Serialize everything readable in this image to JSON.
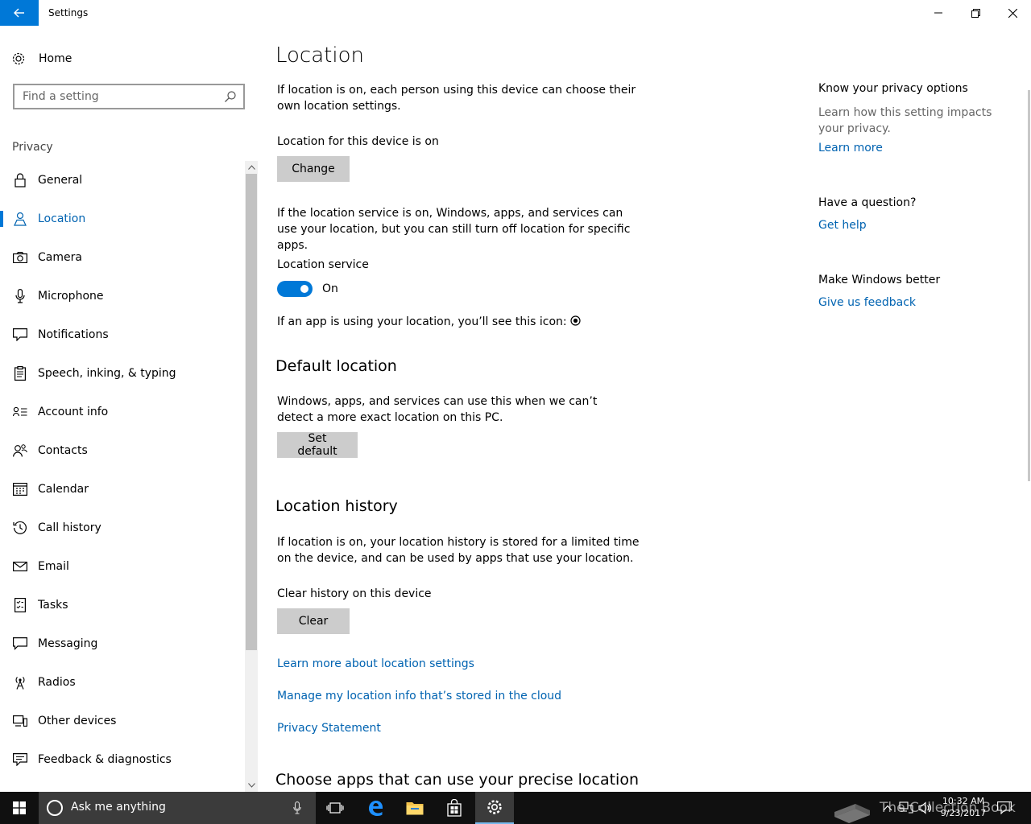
{
  "window": {
    "title": "Settings"
  },
  "sidebar": {
    "home_label": "Home",
    "search_placeholder": "Find a setting",
    "group_label": "Privacy",
    "items": [
      {
        "label": "General",
        "icon": "lock-icon"
      },
      {
        "label": "Location",
        "icon": "person-pin-icon",
        "active": true
      },
      {
        "label": "Camera",
        "icon": "camera-icon"
      },
      {
        "label": "Microphone",
        "icon": "microphone-icon"
      },
      {
        "label": "Notifications",
        "icon": "notification-icon"
      },
      {
        "label": "Speech, inking, & typing",
        "icon": "clipboard-icon"
      },
      {
        "label": "Account info",
        "icon": "account-info-icon"
      },
      {
        "label": "Contacts",
        "icon": "contacts-icon"
      },
      {
        "label": "Calendar",
        "icon": "calendar-icon"
      },
      {
        "label": "Call history",
        "icon": "history-icon"
      },
      {
        "label": "Email",
        "icon": "mail-icon"
      },
      {
        "label": "Tasks",
        "icon": "tasks-icon"
      },
      {
        "label": "Messaging",
        "icon": "message-icon"
      },
      {
        "label": "Radios",
        "icon": "radio-tower-icon"
      },
      {
        "label": "Other devices",
        "icon": "devices-icon"
      },
      {
        "label": "Feedback & diagnostics",
        "icon": "feedback-icon"
      }
    ]
  },
  "main": {
    "title": "Location",
    "intro": "If location is on, each person using this device can choose their own location settings.",
    "device_status": "Location for this device is on",
    "change_button": "Change",
    "service_desc": "If the location service is on, Windows, apps, and services can use your location, but you can still turn off location for specific apps.",
    "service_label": "Location service",
    "service_state": "On",
    "icon_note": "If an app is using your location, you’ll see this icon:",
    "default_heading": "Default location",
    "default_desc": "Windows, apps, and services can use this when we can’t detect a more exact location on this PC.",
    "set_default_button": "Set default",
    "history_heading": "Location history",
    "history_desc": "If location is on, your location history is stored for a limited time on the device, and can be used by apps that use your location.",
    "clear_label": "Clear history on this device",
    "clear_button": "Clear",
    "link_learn_more": "Learn more about location settings",
    "link_manage_cloud": "Manage my location info that’s stored in the cloud",
    "link_privacy": "Privacy Statement",
    "choose_apps_heading": "Choose apps that can use your precise location"
  },
  "right": {
    "privacy_heading": "Know your privacy options",
    "privacy_text": "Learn how this setting impacts your privacy.",
    "learn_more": "Learn more",
    "question_heading": "Have a question?",
    "get_help": "Get help",
    "better_heading": "Make Windows better",
    "feedback": "Give us feedback"
  },
  "taskbar": {
    "search_placeholder": "Ask me anything",
    "time": "10:32 AM",
    "date": "9/23/2017",
    "watermark": "The Collection Book"
  },
  "colors": {
    "accent": "#0078d7",
    "link": "#0063b1",
    "taskbar": "#101010"
  }
}
